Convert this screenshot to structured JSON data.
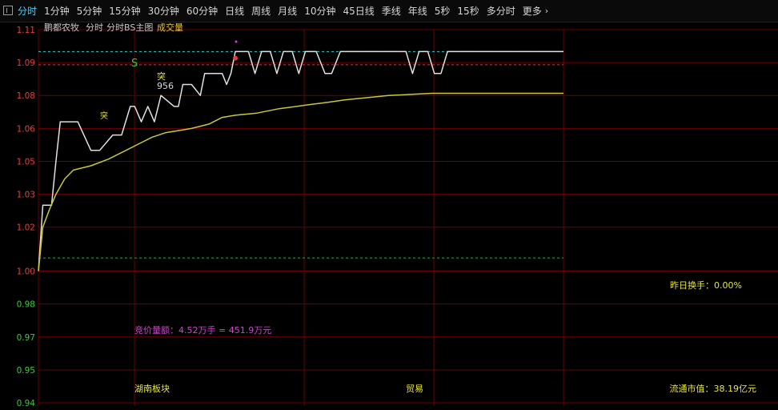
{
  "toolbar": {
    "tabs": [
      "分时",
      "1分钟",
      "5分钟",
      "15分钟",
      "30分钟",
      "60分钟",
      "日线",
      "周线",
      "月线",
      "10分钟",
      "45日线",
      "季线",
      "年线",
      "5秒",
      "15秒",
      "多分时",
      "更多"
    ],
    "active_tab": "分时",
    "more_icon": "chevron-right-icon"
  },
  "chart_header": {
    "stock_name": "鹏都农牧",
    "items": [
      "分时",
      "分时BS主图",
      "成交量"
    ]
  },
  "chart_data": {
    "type": "line",
    "ylim": [
      0.94,
      1.11
    ],
    "ytick_labels": [
      "1.11",
      "1.09",
      "1.08",
      "1.06",
      "1.05",
      "1.03",
      "1.02",
      "1.00",
      "0.98",
      "0.97",
      "0.95",
      "0.94"
    ],
    "ytick_values": [
      1.11,
      1.095,
      1.08,
      1.065,
      1.05,
      1.035,
      1.02,
      1.0,
      0.985,
      0.97,
      0.955,
      0.94
    ],
    "x_minutes_total": 240,
    "series": [
      {
        "name": "",
        "color": "#e0e0e0",
        "points": [
          [
            0,
            1.0
          ],
          [
            2,
            1.03
          ],
          [
            6,
            1.03
          ],
          [
            8,
            1.05
          ],
          [
            10,
            1.068
          ],
          [
            18,
            1.068
          ],
          [
            24,
            1.055
          ],
          [
            28,
            1.055
          ],
          [
            34,
            1.062
          ],
          [
            38,
            1.062
          ],
          [
            42,
            1.075
          ],
          [
            44,
            1.075
          ],
          [
            47,
            1.068
          ],
          [
            50,
            1.075
          ],
          [
            53,
            1.068
          ],
          [
            56,
            1.08
          ],
          [
            62,
            1.075
          ],
          [
            64,
            1.075
          ],
          [
            66,
            1.085
          ],
          [
            70,
            1.085
          ],
          [
            74,
            1.08
          ],
          [
            76,
            1.09
          ],
          [
            84,
            1.09
          ],
          [
            86,
            1.085
          ],
          [
            88,
            1.09
          ],
          [
            90,
            1.1
          ],
          [
            96,
            1.1
          ],
          [
            99,
            1.09
          ],
          [
            102,
            1.1
          ],
          [
            106,
            1.1
          ],
          [
            109,
            1.09
          ],
          [
            112,
            1.1
          ],
          [
            116,
            1.1
          ],
          [
            119,
            1.09
          ],
          [
            122,
            1.1
          ],
          [
            127,
            1.1
          ],
          [
            131,
            1.09
          ],
          [
            134,
            1.09
          ],
          [
            138,
            1.1
          ],
          [
            168,
            1.1
          ],
          [
            171,
            1.09
          ],
          [
            174,
            1.1
          ],
          [
            178,
            1.1
          ],
          [
            181,
            1.09
          ],
          [
            184,
            1.09
          ],
          [
            187,
            1.1
          ],
          [
            240,
            1.1
          ]
        ]
      },
      {
        "name": "",
        "color": "#c8c832",
        "points": [
          [
            0,
            1.0
          ],
          [
            2,
            1.02
          ],
          [
            5,
            1.028
          ],
          [
            8,
            1.035
          ],
          [
            12,
            1.042
          ],
          [
            16,
            1.046
          ],
          [
            24,
            1.048
          ],
          [
            32,
            1.051
          ],
          [
            40,
            1.055
          ],
          [
            46,
            1.058
          ],
          [
            52,
            1.061
          ],
          [
            58,
            1.063
          ],
          [
            64,
            1.064
          ],
          [
            70,
            1.065
          ],
          [
            78,
            1.067
          ],
          [
            84,
            1.07
          ],
          [
            90,
            1.071
          ],
          [
            100,
            1.072
          ],
          [
            110,
            1.074
          ],
          [
            118,
            1.075
          ],
          [
            125,
            1.076
          ],
          [
            133,
            1.077
          ],
          [
            140,
            1.078
          ],
          [
            150,
            1.079
          ],
          [
            160,
            1.08
          ],
          [
            170,
            1.0805
          ],
          [
            180,
            1.081
          ],
          [
            200,
            1.081
          ],
          [
            220,
            1.081
          ],
          [
            240,
            1.081
          ]
        ]
      }
    ],
    "ref_lines": [
      {
        "y": 1.1,
        "color": "#3cc8c8"
      },
      {
        "y": 1.094,
        "color": "#b04060"
      },
      {
        "y": 1.006,
        "color": "#2ea04a"
      }
    ],
    "markers": {
      "S_label": "S",
      "tu_label": "突",
      "volume_label": "956"
    },
    "annotations": {
      "bid_volume": "竞价量额：4.52万手 = 451.9万元",
      "turnover_yesterday": "昨日换手：0.00%",
      "sector_left": "湖南板块",
      "sector_mid": "贸易",
      "float_mktcap": "流通市值：38.19亿元"
    },
    "colors": {
      "grid": "#6e0000",
      "up_axis": "#e04040",
      "down_axis": "#3cc83c",
      "price_line": "#e0e0e0",
      "avg_line": "#c8c832",
      "annotation_purple": "#d040d0",
      "annotation_yellow": "#e6e632"
    }
  }
}
